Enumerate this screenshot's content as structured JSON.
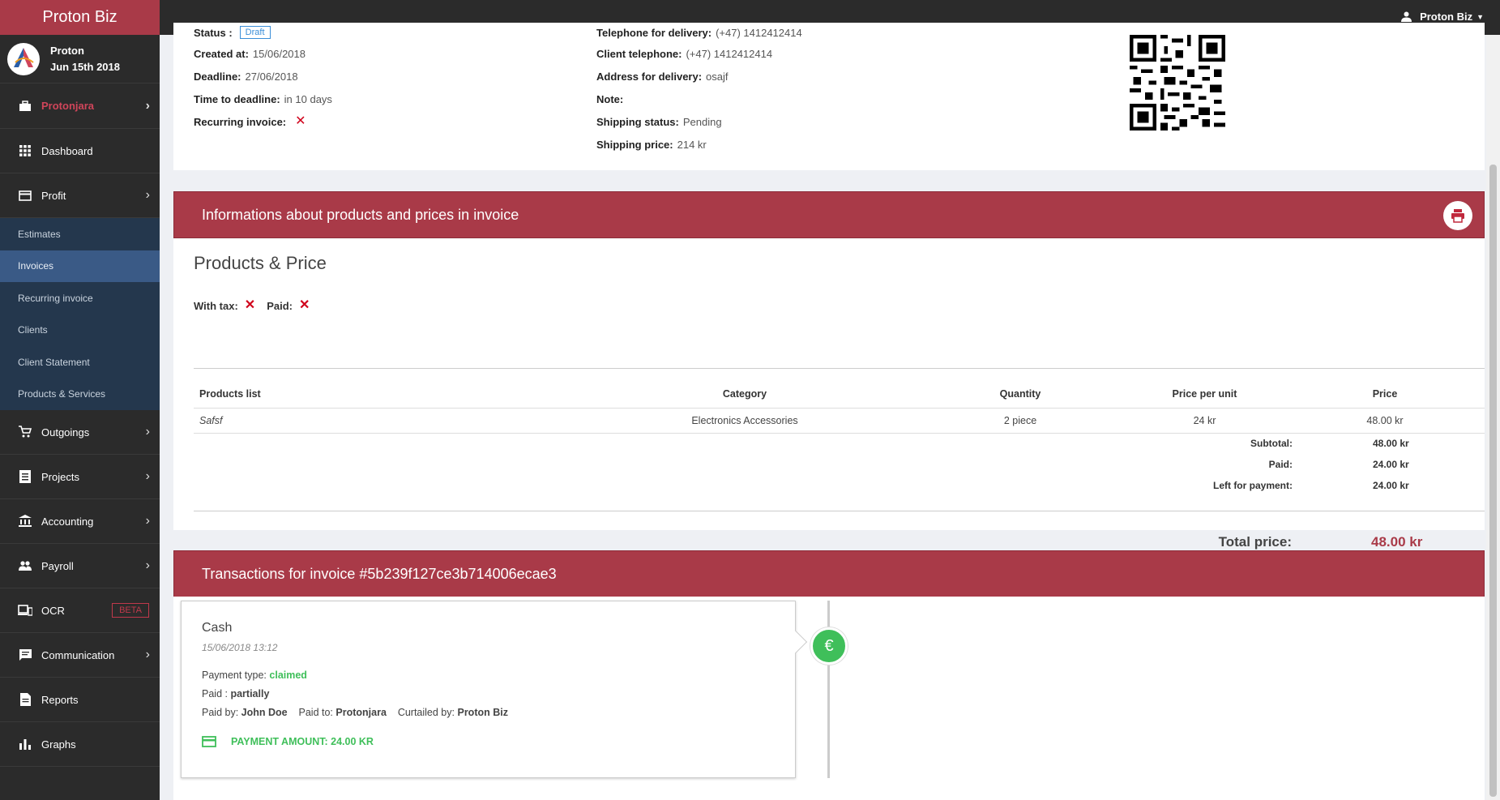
{
  "brand": "Proton Biz",
  "profile": {
    "name": "Proton",
    "date": "Jun 15th 2018"
  },
  "sidebar": {
    "company": "Protonjara",
    "items": [
      {
        "label": "Dashboard",
        "icon": "grid-icon"
      },
      {
        "label": "Profit",
        "icon": "card-icon"
      },
      {
        "label": "Outgoings",
        "icon": "cart-icon"
      },
      {
        "label": "Projects",
        "icon": "list-icon"
      },
      {
        "label": "Accounting",
        "icon": "bank-icon"
      },
      {
        "label": "Payroll",
        "icon": "people-icon"
      },
      {
        "label": "OCR",
        "icon": "devices-icon",
        "badge": "BETA"
      },
      {
        "label": "Communication",
        "icon": "chat-icon"
      },
      {
        "label": "Reports",
        "icon": "doc-icon"
      },
      {
        "label": "Graphs",
        "icon": "bars-icon"
      }
    ],
    "profit_sub": [
      "Estimates",
      "Invoices",
      "Recurring invoice",
      "Clients",
      "Client Statement",
      "Products & Services"
    ]
  },
  "topbar": {
    "user": "Proton Biz"
  },
  "invoice_info": {
    "status_label": "Status :",
    "status_value": "Draft",
    "created_label": "Created at:",
    "created_value": "15/06/2018",
    "deadline_label": "Deadline:",
    "deadline_value": "27/06/2018",
    "ttd_label": "Time to deadline:",
    "ttd_value": "in 10 days",
    "recurring_label": "Recurring invoice:",
    "tel_delivery_label": "Telephone for delivery:",
    "tel_delivery_value": "(+47) 1412412414",
    "client_tel_label": "Client telephone:",
    "client_tel_value": "(+47) 1412412414",
    "address_label": "Address for delivery:",
    "address_value": "osajf",
    "note_label": "Note:",
    "shipping_status_label": "Shipping status:",
    "shipping_status_value": "Pending",
    "shipping_price_label": "Shipping price:",
    "shipping_price_value": "214 kr"
  },
  "products_panel": {
    "header": "Informations about products and prices in invoice",
    "title": "Products & Price",
    "with_tax": "With tax:",
    "paid": "Paid:",
    "columns": [
      "Products list",
      "Category",
      "Quantity",
      "Price per unit",
      "Price"
    ],
    "rows": [
      {
        "product": "Safsf",
        "category": "Electronics Accessories",
        "quantity": "2 piece",
        "ppu": "24 kr",
        "price": "48.00 kr"
      }
    ],
    "subtotal_label": "Subtotal:",
    "subtotal": "48.00 kr",
    "paid_label": "Paid:",
    "paid_value": "24.00 kr",
    "left_label": "Left for payment:",
    "left_value": "24.00 kr",
    "total_label": "Total price:",
    "total_value": "48.00 kr"
  },
  "transactions": {
    "header": "Transactions for invoice #5b239f127ce3b714006ecae3",
    "item": {
      "title": "Cash",
      "date": "15/06/2018 13:12",
      "payment_type_label": "Payment type:",
      "payment_type": "claimed",
      "paid_label": "Paid :",
      "paid_value": "partially",
      "paid_by_label": "Paid by:",
      "paid_by": "John Doe",
      "paid_to_label": "Paid to:",
      "paid_to": "Protonjara",
      "curtailed_label": "Curtailed by:",
      "curtailed_by": "Proton Biz",
      "amount": "PAYMENT AMOUNT: 24.00 KR",
      "dot_icon": "euro-icon"
    }
  }
}
